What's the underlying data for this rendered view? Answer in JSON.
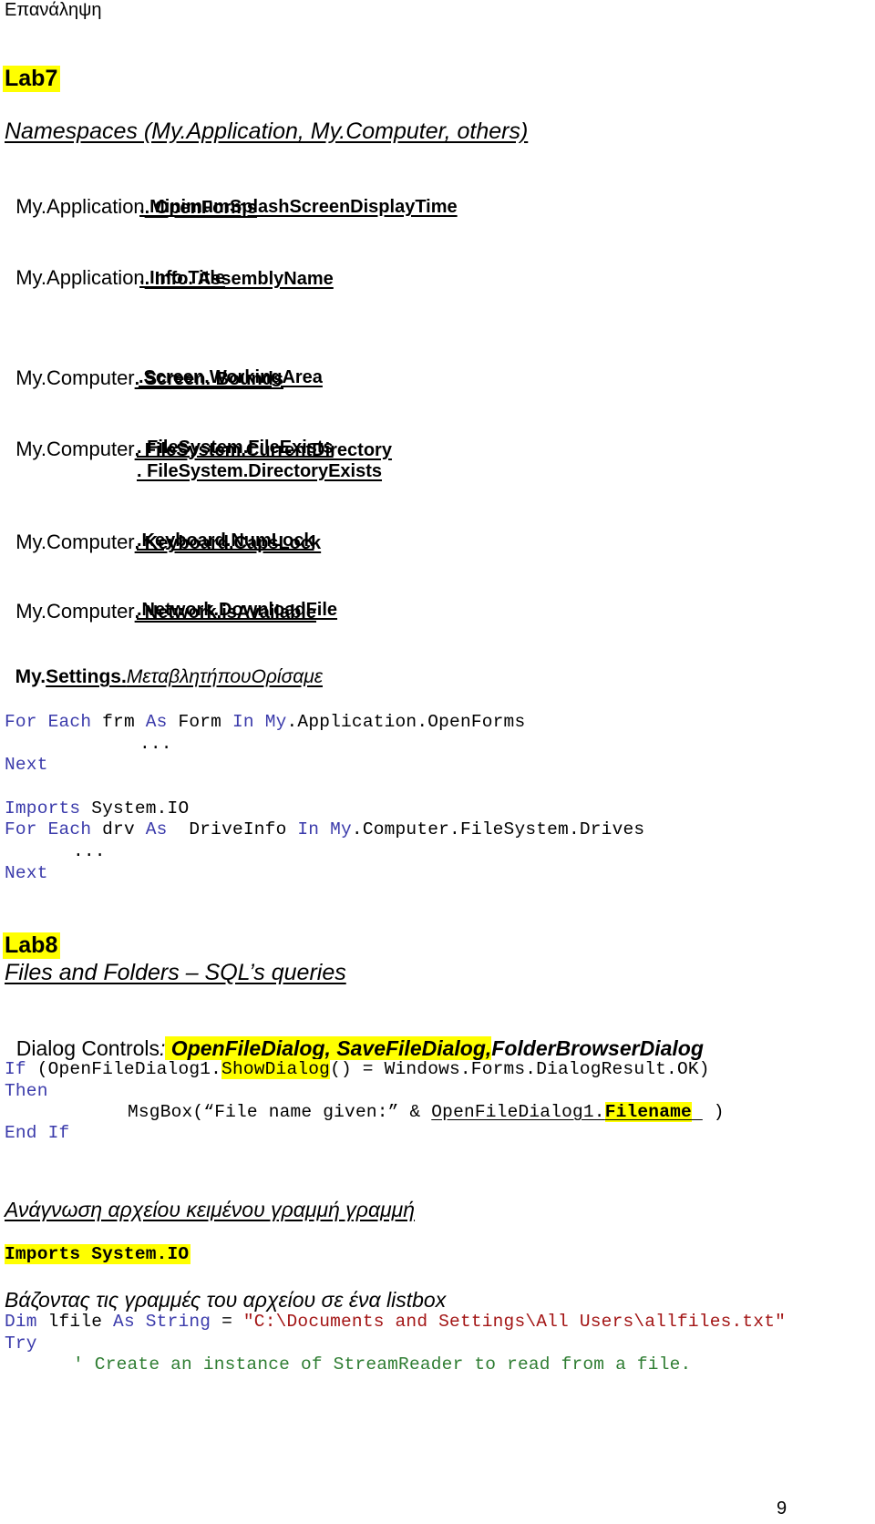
{
  "page": {
    "header": "Επανάληψη",
    "page_number": "9",
    "highlight_color": "#ffff00",
    "keyword_color": "#3b3bab",
    "string_color": "#a31515",
    "comment_color": "#2e7d32"
  },
  "lab7": {
    "label": "Lab7",
    "title": "Namespaces (My.Application, My.Computer, others)",
    "groups": [
      {
        "prefix": "My.Application",
        "items": [
          ". OpenForms",
          ". MinimumSplashScreenDisplayTime"
        ]
      },
      {
        "prefix": "My.Application",
        "items": [
          ". Info. AssemblyName",
          ". Info.Title"
        ]
      },
      {
        "prefix": "My.Computer",
        "items": [
          ". Screen. Bounds",
          ".Screen.WorkingArea"
        ]
      },
      {
        "prefix": "My.Computer",
        "items": [
          ". FileSystem.CurrentDirectory",
          ". FileSystem.FileExists",
          ". FileSystem.DirectoryExists"
        ]
      },
      {
        "prefix": "My.Computer",
        "items": [
          ". Keyboard.CapsLock",
          ".Keyboard.NumLock"
        ]
      },
      {
        "prefix": "My.Computer",
        "items": [
          ". Network.isAvailable",
          ".Network.DownloadFile"
        ]
      }
    ],
    "settings": {
      "prefix": "My.",
      "member": "Settings.",
      "variable": "ΜεταβλητήπουΟρίσαμε"
    },
    "code1": {
      "line1": {
        "kw1": "For",
        "kw2": "Each",
        "var": " frm ",
        "kw3": "As",
        "type": " Form ",
        "kw4": "In",
        "kw5": "My",
        "rest": ".Application.OpenForms"
      },
      "ellipsis": "...",
      "next": "Next"
    },
    "code2": {
      "imports_kw": "Imports",
      "imports_ns": " System.IO",
      "line": {
        "kw1": "For",
        "kw2": "Each",
        "var": " drv ",
        "kw3": "As",
        "type": "  DriveInfo ",
        "kw4": "In",
        "kw5": "My",
        "rest": ".Computer.FileSystem.Drives"
      },
      "ellipsis": "...",
      "next": "Next"
    }
  },
  "lab8": {
    "label": "Lab8",
    "title": "Files and Folders – SQL’s queries",
    "dialog_controls": {
      "label": "Dialog Controls",
      "colon": ":",
      "highlighted": " OpenFileDialog, SaveFileDialog,",
      "plain": "FolderBrowserDialog"
    },
    "if_block": {
      "if_kw": "If",
      "cond_a": " (OpenFileDialog1.",
      "cond_hl": "ShowDialog",
      "cond_b": "() = Windows.Forms.DialogResult.OK)",
      "then_kw": "Then",
      "msgbox_a": "MsgBox(“File name given:” & ",
      "msgbox_ul": "OpenFileDialog1.",
      "msgbox_hl": "Filename",
      "msgbox_end": " )",
      "end_if": "End If"
    },
    "read_title": "Ανάγνωση αρχείου κειμένου γραμμή γραμμή",
    "imports_highlighted": "Imports System.IO",
    "listbox_title": "Βάζοντας τις γραμμές του αρχείου σε ένα listbox",
    "dim_line": {
      "dim_kw": "Dim",
      "var": " lfile ",
      "as_kw": "As",
      "sp": " ",
      "type_kw": "String",
      "eq": " = ",
      "value": "\"C:\\Documents and Settings\\All Users\\allfiles.txt\""
    },
    "try_kw": "Try",
    "comment": "' Create an instance of StreamReader to read from a file."
  }
}
